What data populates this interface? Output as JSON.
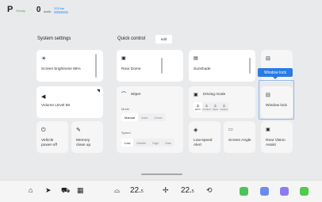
{
  "status": {
    "gear": "P",
    "gear_sub": "Ready",
    "speed": "0",
    "speed_unit": "km/h",
    "range": "376 km"
  },
  "sections": {
    "system_settings": "System settings",
    "quick_control": "Quick control",
    "edit": "edit"
  },
  "cards": {
    "screen_brightness": "Screen brightness  85%",
    "volume": "Volume LEvel  68",
    "vehicle_power_off": "Vehicle\npower-off",
    "memory_clean_up": "Memory\nclean up",
    "rear_dome": "Rear Dome",
    "sunshade": "Sunshade",
    "wiper": {
      "title": "Wiper",
      "mode_label": "Mode",
      "modes": [
        "Manual",
        "Auto",
        "Close"
      ],
      "mode_selected": "Manual",
      "speed_label": "Speed",
      "speeds": [
        "Low",
        "Middle",
        "High",
        "Max"
      ],
      "speed_selected": "Low"
    },
    "driving_mode": {
      "title": "Driving mode",
      "modes": [
        "ECO",
        "Comfort",
        "Sport",
        "Custom"
      ],
      "selected": "ECO"
    },
    "low_speed_alert": "Low-speed\nAlert",
    "screen_angle": "Screen Angle",
    "rear_vision_assist": "Rear Vision\nAssist",
    "window_lock": "Window lock"
  },
  "tooltip": "Window lock",
  "dock": {
    "temp_left": "22.",
    "temp_left_unit": "5",
    "temp_right": "22.",
    "temp_right_unit": "5"
  },
  "colors": {
    "accent": "#2a7be4",
    "app_green": "#4cc35a",
    "app_blue": "#6c8cf0",
    "app_purple": "#8a7cf0",
    "app_lime": "#54c94c"
  }
}
